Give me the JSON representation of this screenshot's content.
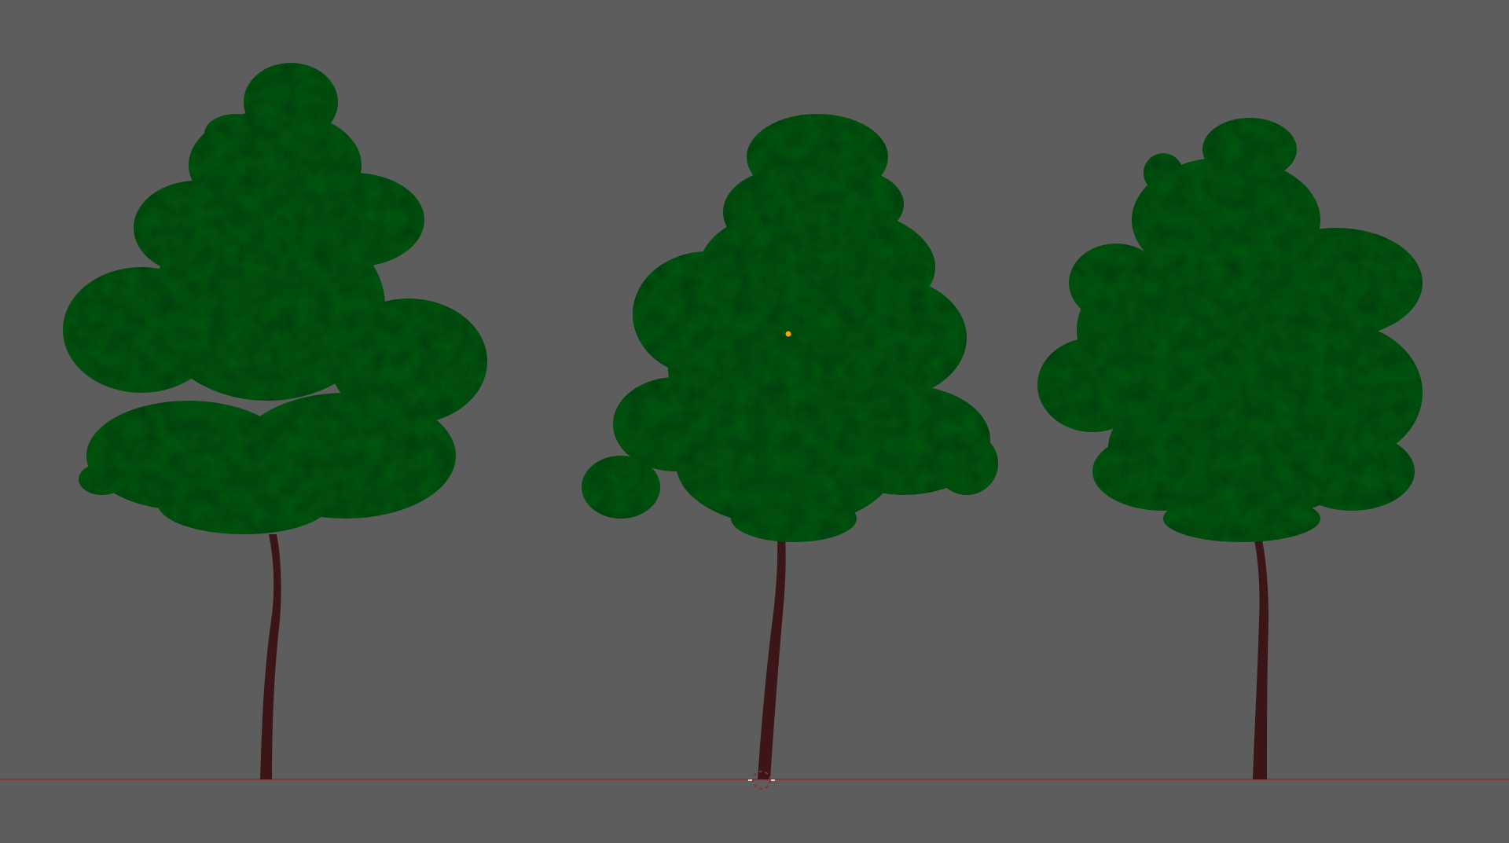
{
  "viewport": {
    "background_color": "#5d5d5d",
    "ground_line_color": "#8a2e2e",
    "origin_marker_color": "#ffffff",
    "active_object_origin_color": "#ffa500"
  },
  "scene": {
    "objects": [
      {
        "name": "tree",
        "foliage_color": "#0f5a19",
        "trunk_color": "#3c1616"
      },
      {
        "name": "tree",
        "foliage_color": "#0f5a19",
        "trunk_color": "#3c1616"
      },
      {
        "name": "tree",
        "foliage_color": "#0f5a19",
        "trunk_color": "#3c1616"
      }
    ]
  }
}
